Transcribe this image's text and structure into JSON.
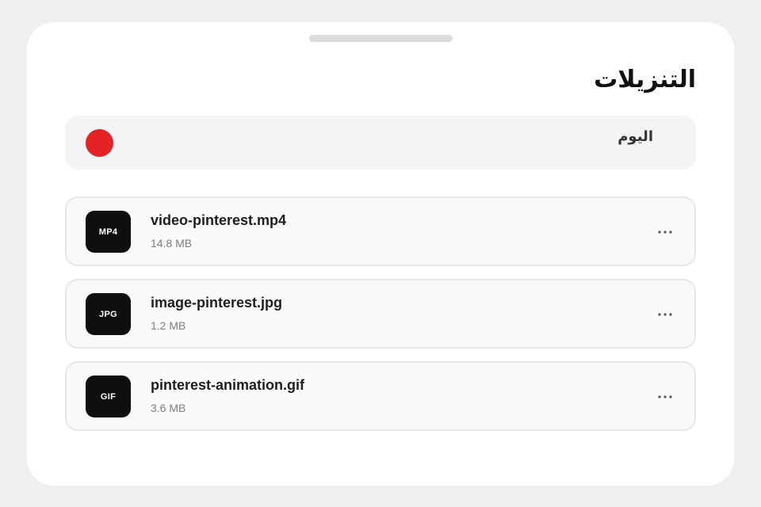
{
  "colors": {
    "accent_record": "#e52324",
    "background": "#efefef",
    "sheet": "#ffffff",
    "badge": "#0f0f0f"
  },
  "page": {
    "title": "التنزيلات"
  },
  "section": {
    "label": "اليوم",
    "indicator_icon": "red-record-dot"
  },
  "files": [
    {
      "badge": "MP4",
      "name": "video-pinterest.mp4",
      "size": "14.8 MB",
      "menu_icon": "more-horizontal-icon"
    },
    {
      "badge": "JPG",
      "name": "image-pinterest.jpg",
      "size": "1.2 MB",
      "menu_icon": "more-horizontal-icon"
    },
    {
      "badge": "GIF",
      "name": "pinterest-animation.gif",
      "size": "3.6 MB",
      "menu_icon": "more-horizontal-icon"
    }
  ]
}
